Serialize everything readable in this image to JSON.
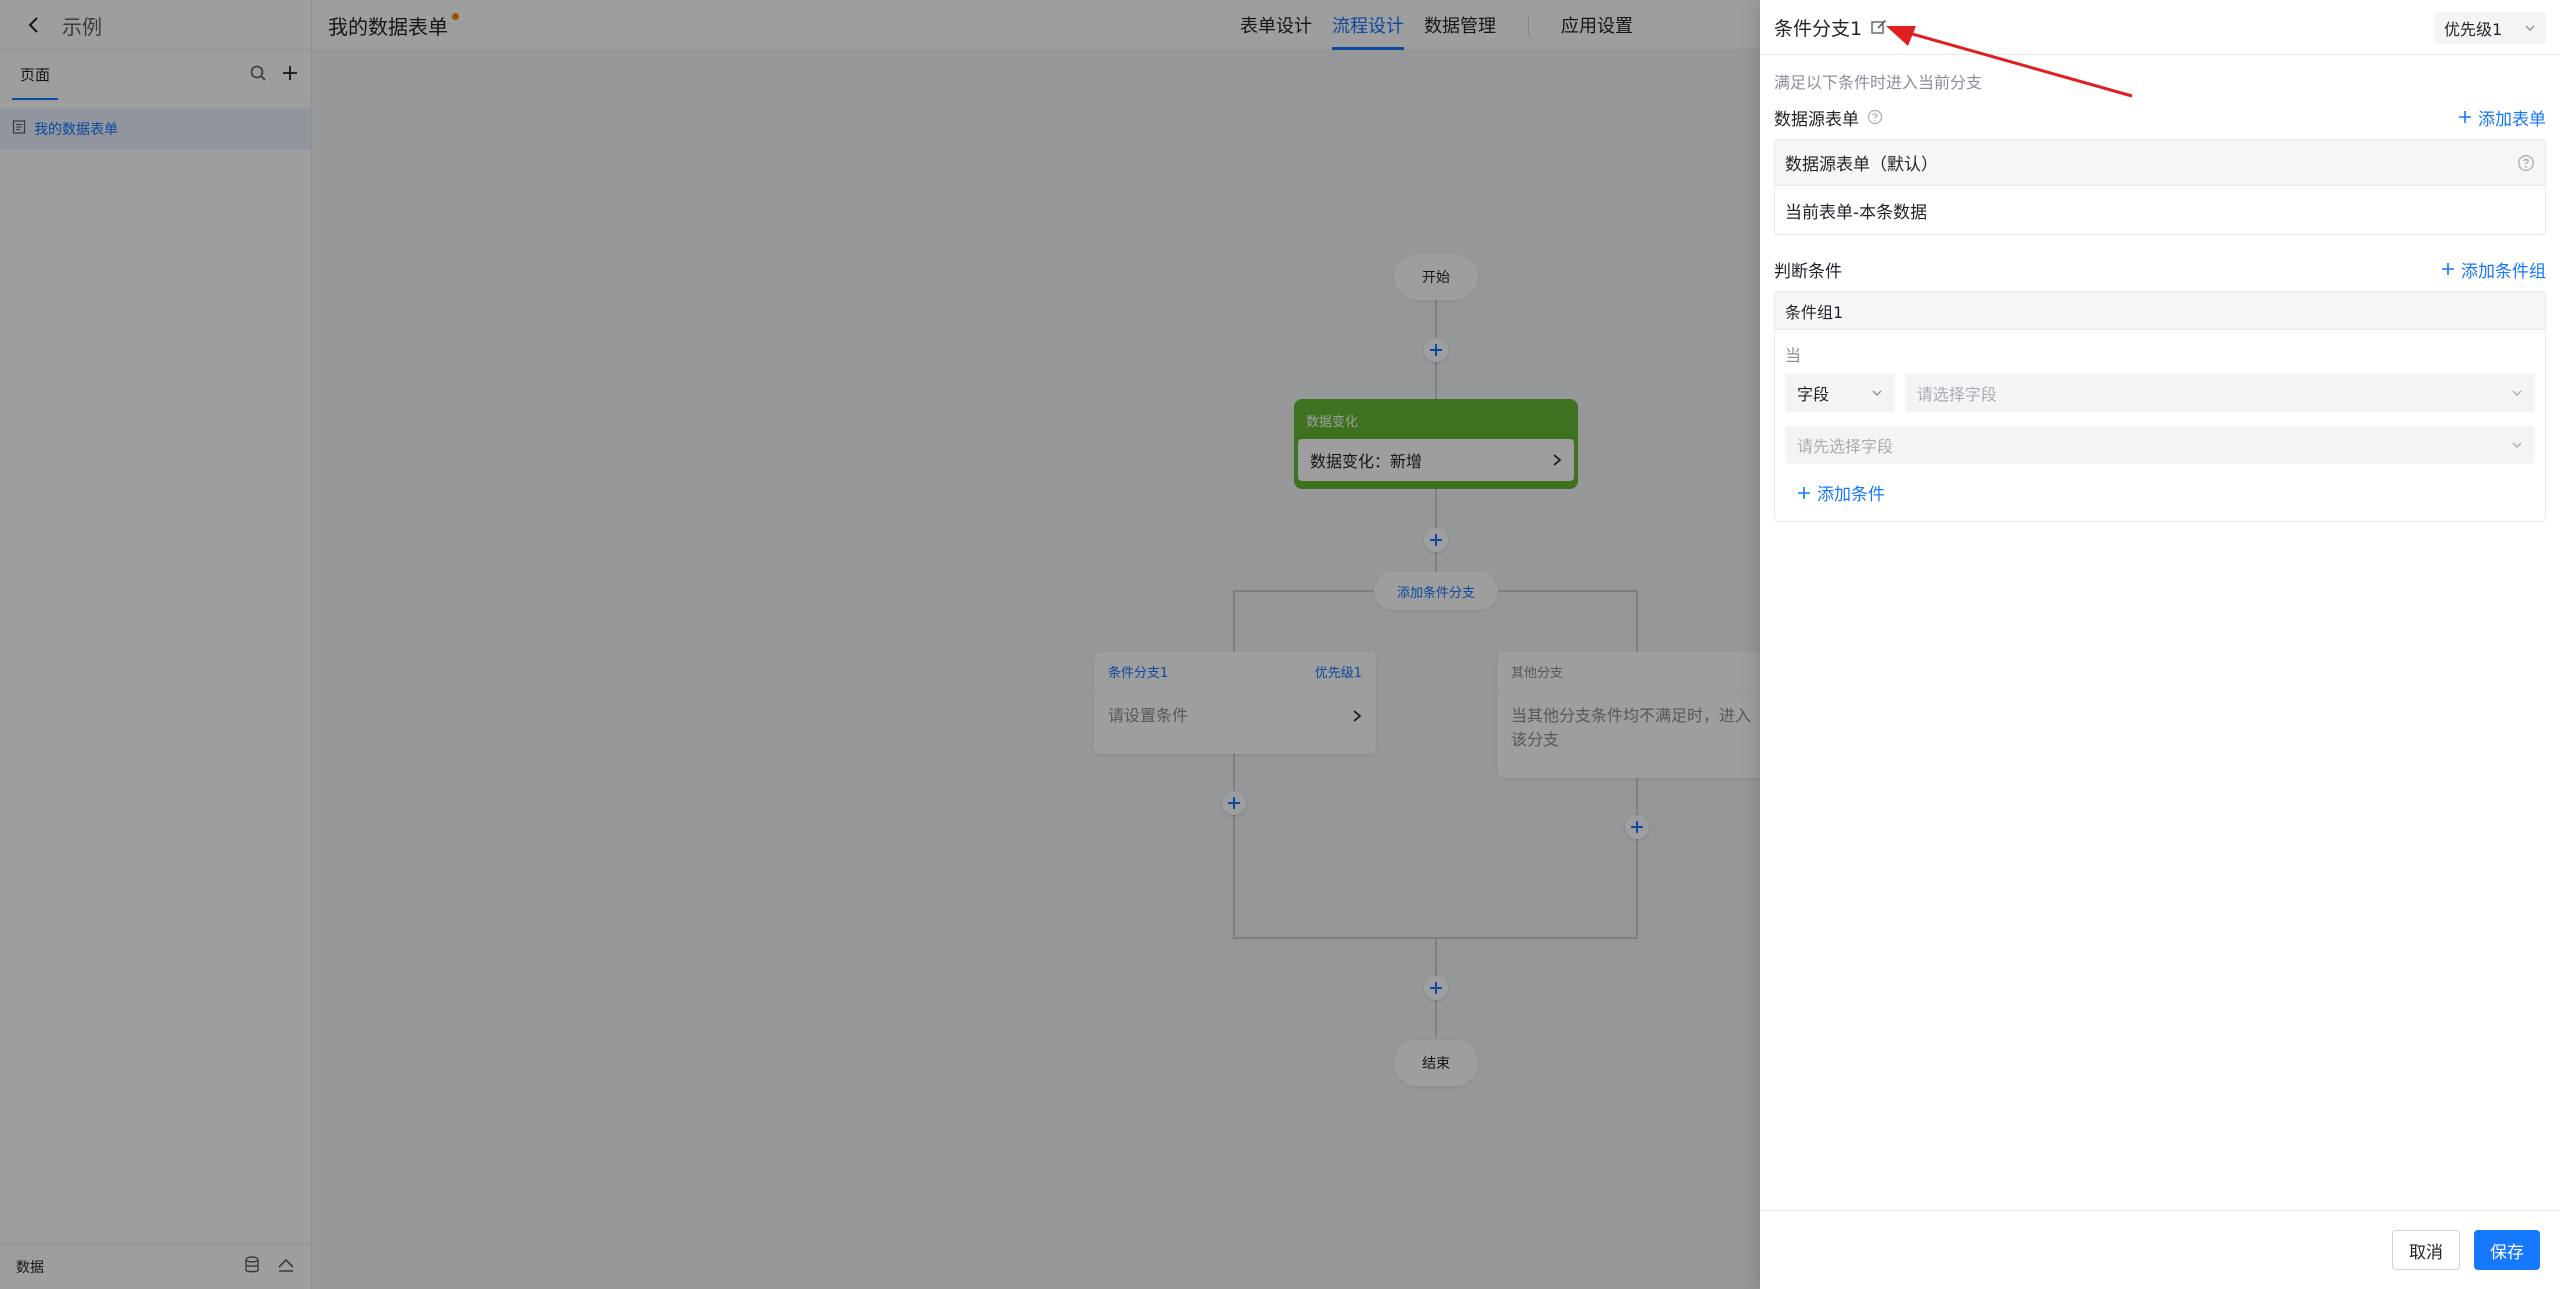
{
  "topbar": {
    "back_label": "示例",
    "app_title": "我的数据表单",
    "tabs": [
      {
        "label": "表单设计"
      },
      {
        "label": "流程设计"
      },
      {
        "label": "数据管理"
      },
      {
        "label": "应用设置"
      }
    ],
    "active_tab": "流程设计"
  },
  "sidebar": {
    "tab_label": "页面",
    "items": [
      {
        "label": "我的数据表单"
      }
    ],
    "footer_label": "数据"
  },
  "flow": {
    "start_label": "开始",
    "trigger": {
      "title": "数据变化",
      "body": "数据变化：新增"
    },
    "add_branch_label": "添加条件分支",
    "branch1": {
      "title": "条件分支1",
      "priority": "优先级1",
      "body": "请设置条件"
    },
    "branch_other": {
      "title": "其他分支",
      "body": "当其他分支条件均不满足时，进入该分支"
    },
    "end_label": "结束"
  },
  "drawer": {
    "title": "条件分支1",
    "priority_value": "优先级1",
    "hint": "满足以下条件时进入当前分支",
    "datasource": {
      "label": "数据源表单",
      "add_label": "添加表单",
      "header": "数据源表单（默认）",
      "value": "当前表单-本条数据"
    },
    "conditions": {
      "label": "判断条件",
      "add_group_label": "添加条件组",
      "group_title": "条件组1",
      "when_label": "当",
      "field_type": "字段",
      "field_placeholder": "请选择字段",
      "value_placeholder": "请先选择字段",
      "add_condition_label": "添加条件"
    },
    "footer": {
      "cancel_label": "取消",
      "save_label": "保存"
    }
  },
  "colors": {
    "accent": "#1677ff",
    "trigger_green": "#64b832",
    "annotation_arrow": "#e02020"
  }
}
